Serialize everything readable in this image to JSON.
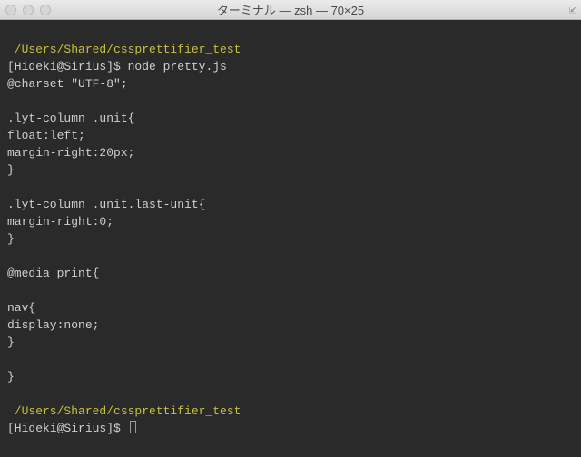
{
  "window": {
    "title": "ターミナル — zsh — 70×25"
  },
  "terminal": {
    "cwd1": " /Users/Shared/cssprettifier_test",
    "prompt1": "[Hideki@Sirius]$ ",
    "command1": "node pretty.js",
    "output_lines": [
      "@charset \"UTF-8\";",
      "",
      ".lyt-column .unit{",
      "float:left;",
      "margin-right:20px;",
      "}",
      "",
      ".lyt-column .unit.last-unit{",
      "margin-right:0;",
      "}",
      "",
      "@media print{",
      "",
      "nav{",
      "display:none;",
      "}",
      "",
      "}",
      ""
    ],
    "cwd2": " /Users/Shared/cssprettifier_test",
    "prompt2": "[Hideki@Sirius]$ "
  }
}
